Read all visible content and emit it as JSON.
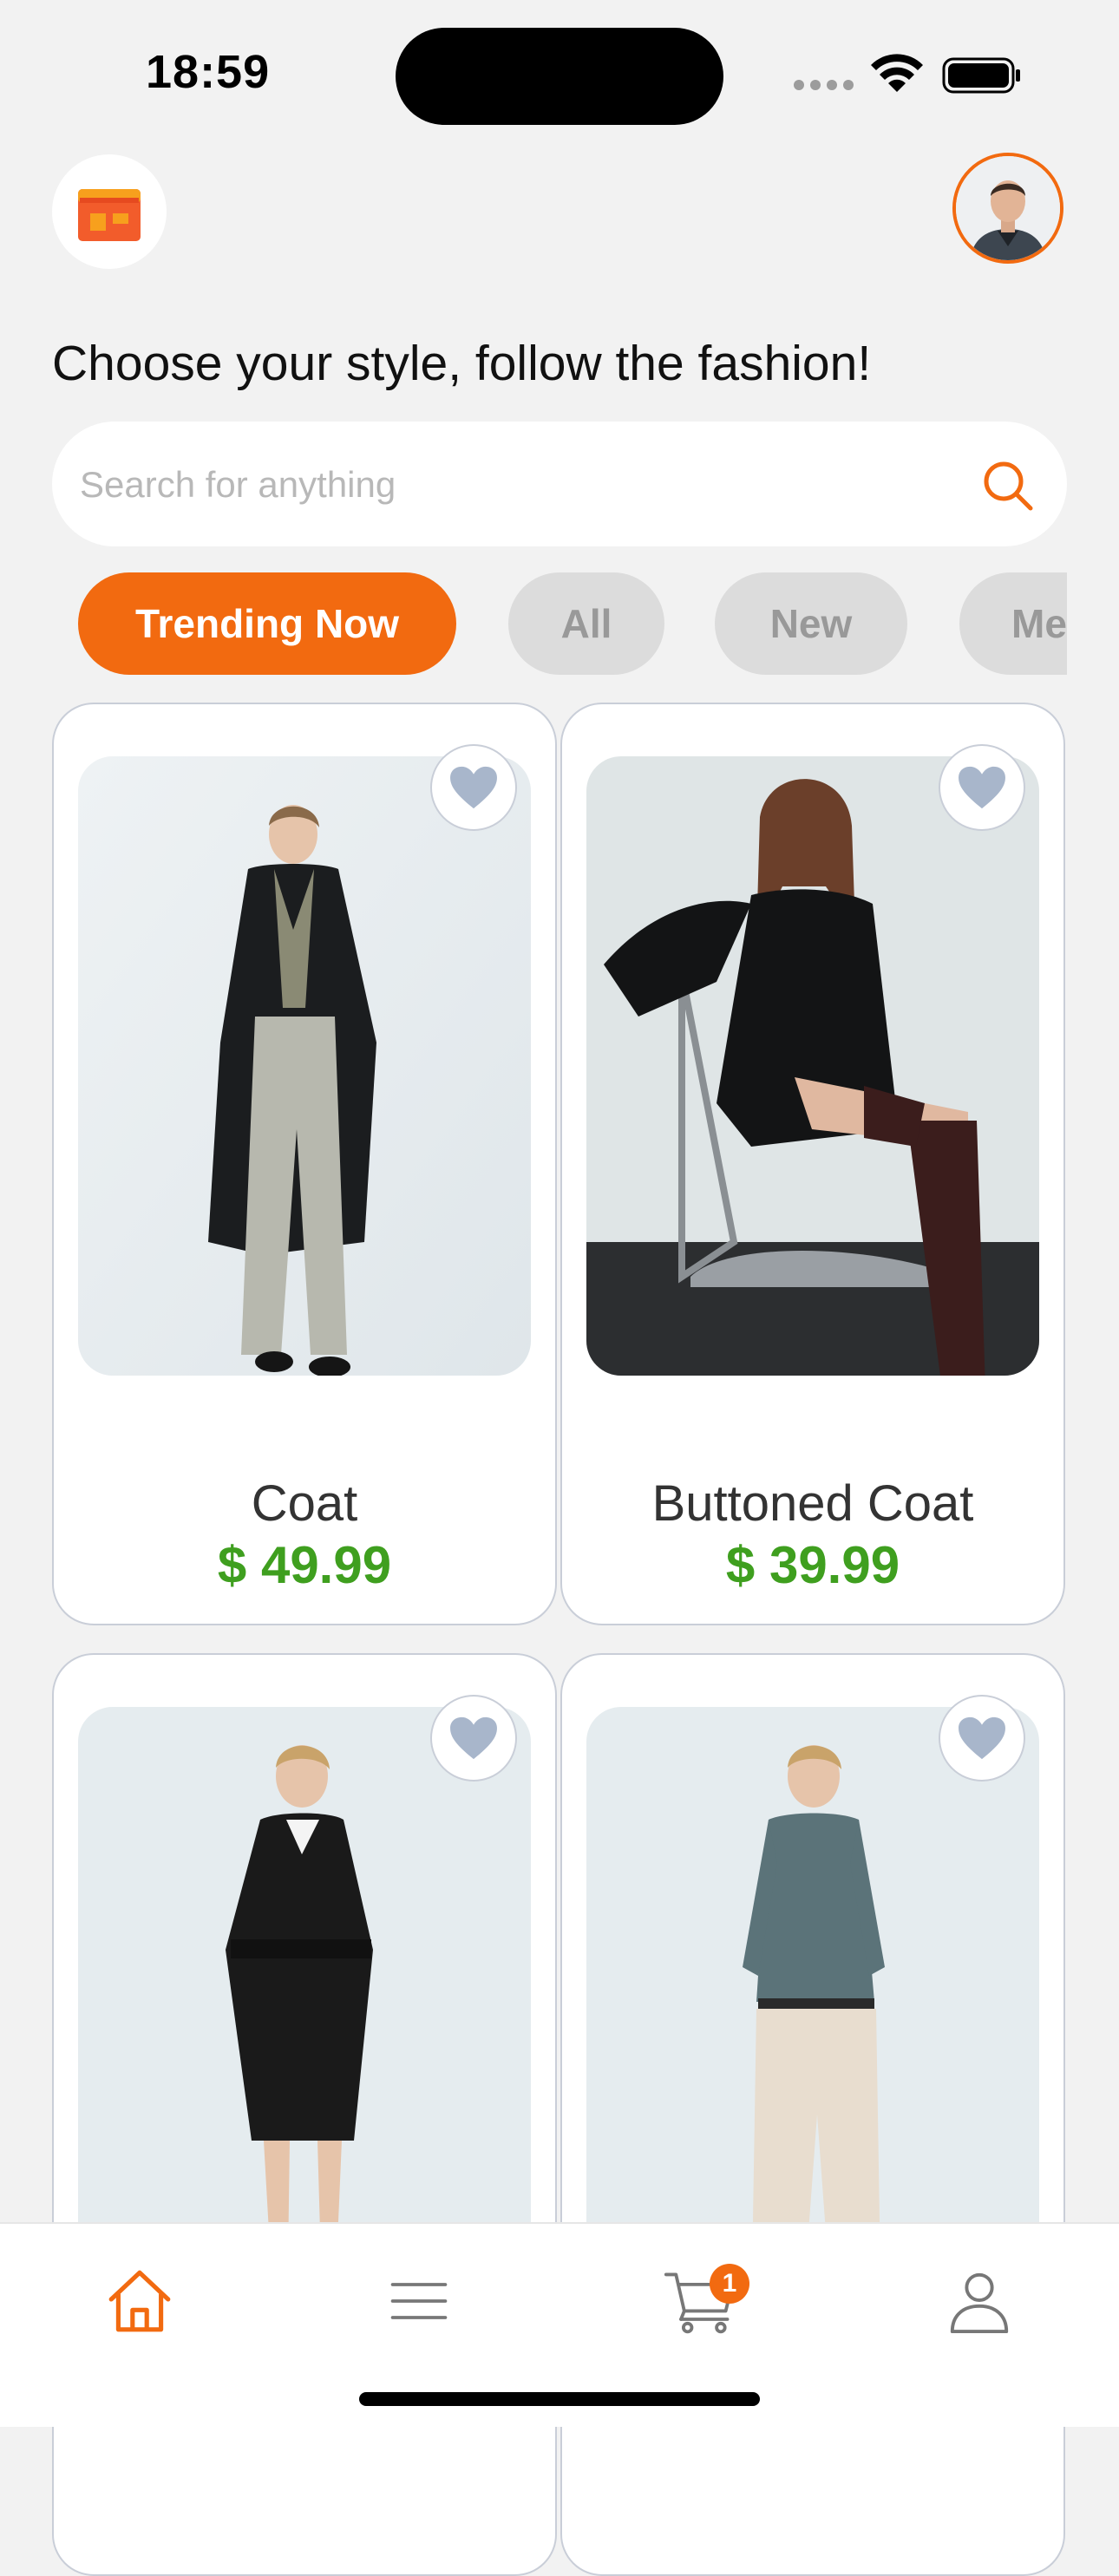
{
  "status_bar": {
    "time": "18:59"
  },
  "header": {
    "store_icon": "store-icon",
    "avatar_icon": "avatar"
  },
  "headline": "Choose your style, follow the fashion!",
  "search": {
    "placeholder": "Search for anything",
    "icon": "search-icon"
  },
  "categories": [
    {
      "label": "Trending Now",
      "active": true
    },
    {
      "label": "All",
      "active": false
    },
    {
      "label": "New",
      "active": false
    },
    {
      "label": "Men",
      "active": false
    }
  ],
  "products": [
    {
      "name": "Coat",
      "price": "$ 49.99"
    },
    {
      "name": "Buttoned Coat",
      "price": "$ 39.99"
    },
    {
      "name": "",
      "price": ""
    },
    {
      "name": "",
      "price": ""
    }
  ],
  "tabbar": {
    "items": [
      "home-icon",
      "menu-icon",
      "cart-icon",
      "profile-icon"
    ],
    "cart_count": "1"
  },
  "colors": {
    "accent": "#f26a10",
    "price": "#3f9f1f",
    "background": "#f2f2f2"
  }
}
